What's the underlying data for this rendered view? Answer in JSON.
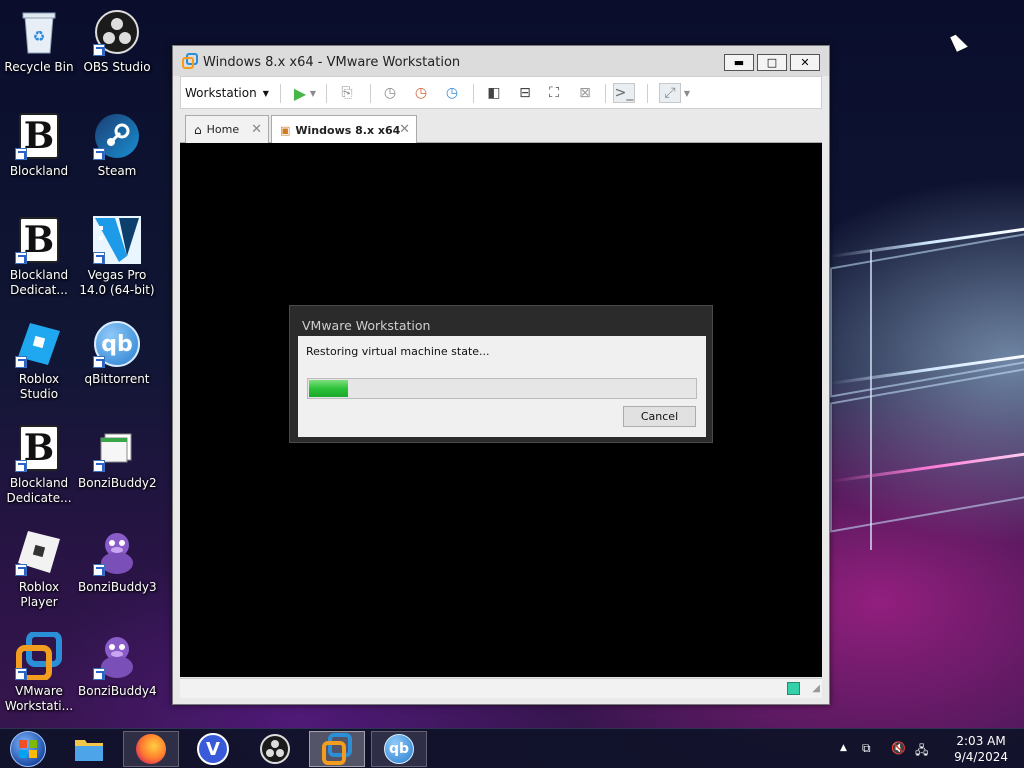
{
  "desktop": {
    "icons": [
      {
        "label": "Recycle Bin",
        "icon": "recycle-bin-icon"
      },
      {
        "label": "OBS Studio",
        "icon": "obs-icon"
      },
      {
        "label": "Blockland",
        "icon": "blockland-icon"
      },
      {
        "label": "Steam",
        "icon": "steam-icon"
      },
      {
        "label": "Blockland Dedicat...",
        "icon": "blockland-icon"
      },
      {
        "label": "Vegas Pro 14.0 (64-bit)",
        "icon": "vegas-icon"
      },
      {
        "label": "Roblox Studio",
        "icon": "roblox-studio-icon"
      },
      {
        "label": "qBittorrent",
        "icon": "qbittorrent-icon"
      },
      {
        "label": "Blockland Dedicate...",
        "icon": "blockland-icon"
      },
      {
        "label": "BonziBuddy2",
        "icon": "bonzibuddy-icon"
      },
      {
        "label": "Roblox Player",
        "icon": "roblox-player-icon"
      },
      {
        "label": "BonziBuddy3",
        "icon": "bonzibuddy-icon"
      },
      {
        "label": "VMware Workstati...",
        "icon": "vmware-icon"
      },
      {
        "label": "BonziBuddy4",
        "icon": "bonzibuddy-icon"
      }
    ]
  },
  "window": {
    "title": "Windows 8.x x64 - VMware Workstation",
    "menu_label": "Workstation",
    "minimize": "▬",
    "maximize": "□",
    "close": "✕",
    "tabs": [
      {
        "label": "Home"
      },
      {
        "label": "Windows 8.x x64"
      }
    ]
  },
  "dialog": {
    "title": "VMware Workstation",
    "message": "Restoring virtual machine state...",
    "progress_percent": 10,
    "cancel_label": "Cancel"
  },
  "taskbar": {
    "apps": [
      "start-icon",
      "file-explorer-icon",
      "firefox-icon",
      "v-icon",
      "obs-icon",
      "vmware-icon",
      "qbittorrent-icon"
    ],
    "time": "2:03 AM",
    "date": "9/4/2024"
  },
  "colors": {
    "progress_green": "#2cc23a",
    "vmware_orange": "#f29d1f",
    "vmware_blue": "#2a8fd6"
  }
}
